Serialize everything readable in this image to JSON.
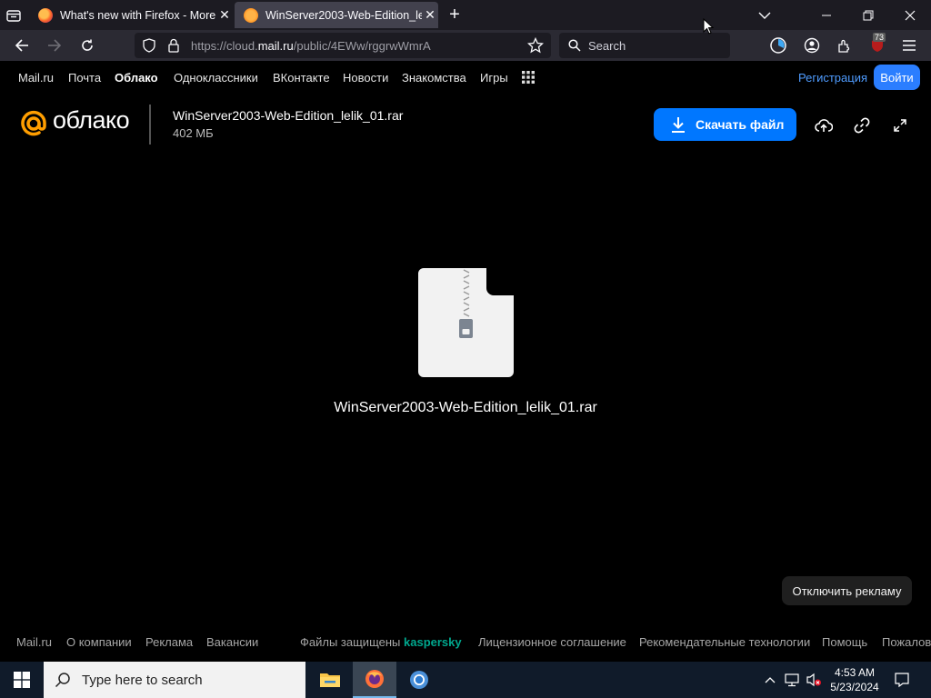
{
  "browser": {
    "tabs": [
      {
        "title": "What's new with Firefox - More",
        "close": "✕"
      },
      {
        "title": "WinServer2003-Web-Edition_lelik_",
        "close": "✕"
      }
    ],
    "new_tab": "+",
    "url_prefix": "https://cloud.",
    "url_domain": "mail.ru",
    "url_path": "/public/4EWw/rggrwWmrA",
    "search_placeholder": "Search",
    "badge_count": "73"
  },
  "portal": {
    "links": [
      "Mail.ru",
      "Почта",
      "Облако",
      "Одноклассники",
      "ВКонтакте",
      "Новости",
      "Знакомства",
      "Игры"
    ],
    "register": "Регистрация",
    "login": "Войти"
  },
  "cloud": {
    "logo_text": "облако",
    "file_name": "WinServer2003-Web-Edition_lelik_01.rar",
    "file_size": "402 МБ",
    "download_label": "Скачать файл",
    "caption": "WinServer2003-Web-Edition_lelik_01.rar",
    "disable_ads": "Отключить рекламу",
    "accent_color": "#0077ff",
    "logo_color": "#ff9e00"
  },
  "footer": {
    "links": [
      "Mail.ru",
      "О компании",
      "Реклама",
      "Вакансии"
    ],
    "protected": "Файлы защищены",
    "kaspersky": "kaspersky",
    "links2": [
      "Лицензионное соглашение",
      "Рекомендательные технологии",
      "Помощь",
      "Пожалов"
    ]
  },
  "taskbar": {
    "search_placeholder": "Type here to search",
    "time": "4:53 AM",
    "date": "5/23/2024"
  }
}
